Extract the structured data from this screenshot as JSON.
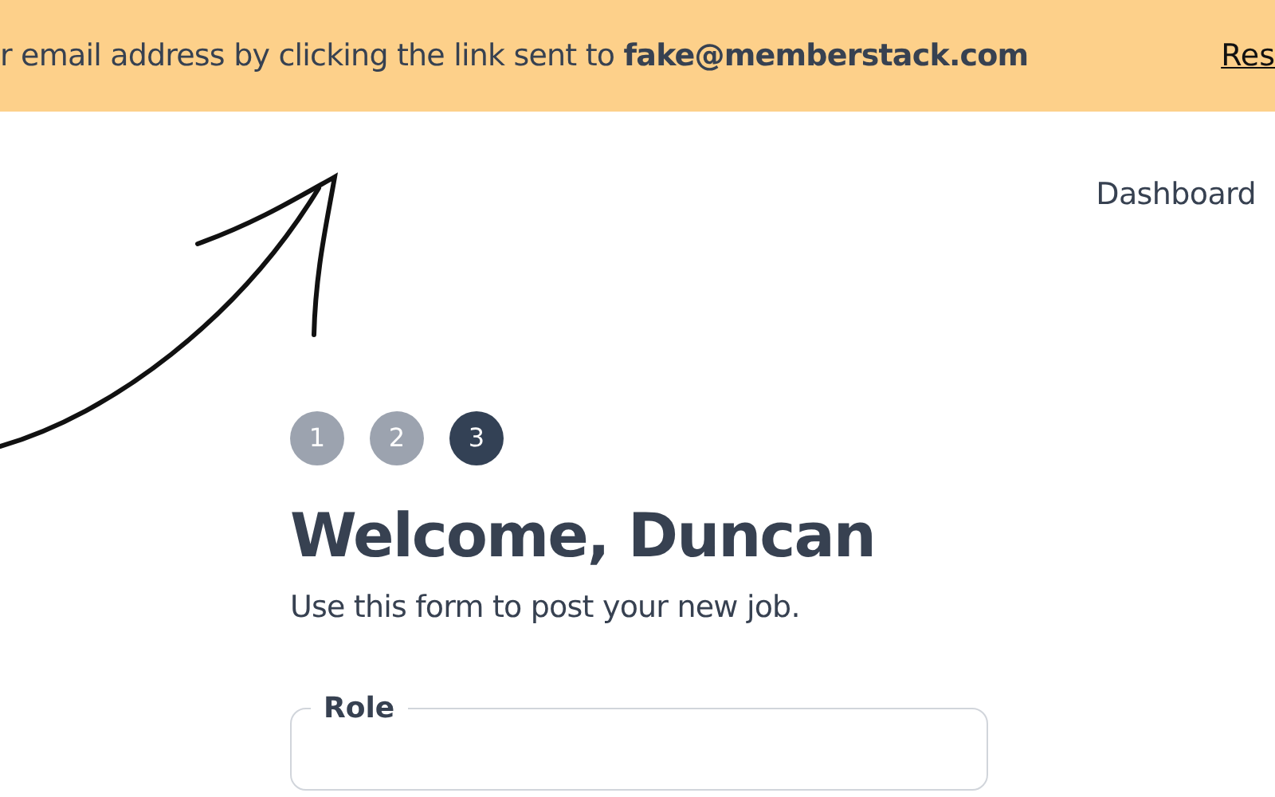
{
  "banner": {
    "message": "r email address by clicking the link sent to **fake@memberstack.com**",
    "link": "Res"
  },
  "nav": {
    "links": [
      {
        "label": "Dashboard"
      }
    ]
  },
  "steps": [
    {
      "label": "1",
      "selected": false
    },
    {
      "label": "2",
      "selected": false
    },
    {
      "label": "3",
      "selected": true
    }
  ],
  "heading": "Welcome, Duncan",
  "subtitle": "Use this form to post your new job.",
  "form": {
    "legend": "Role"
  }
}
